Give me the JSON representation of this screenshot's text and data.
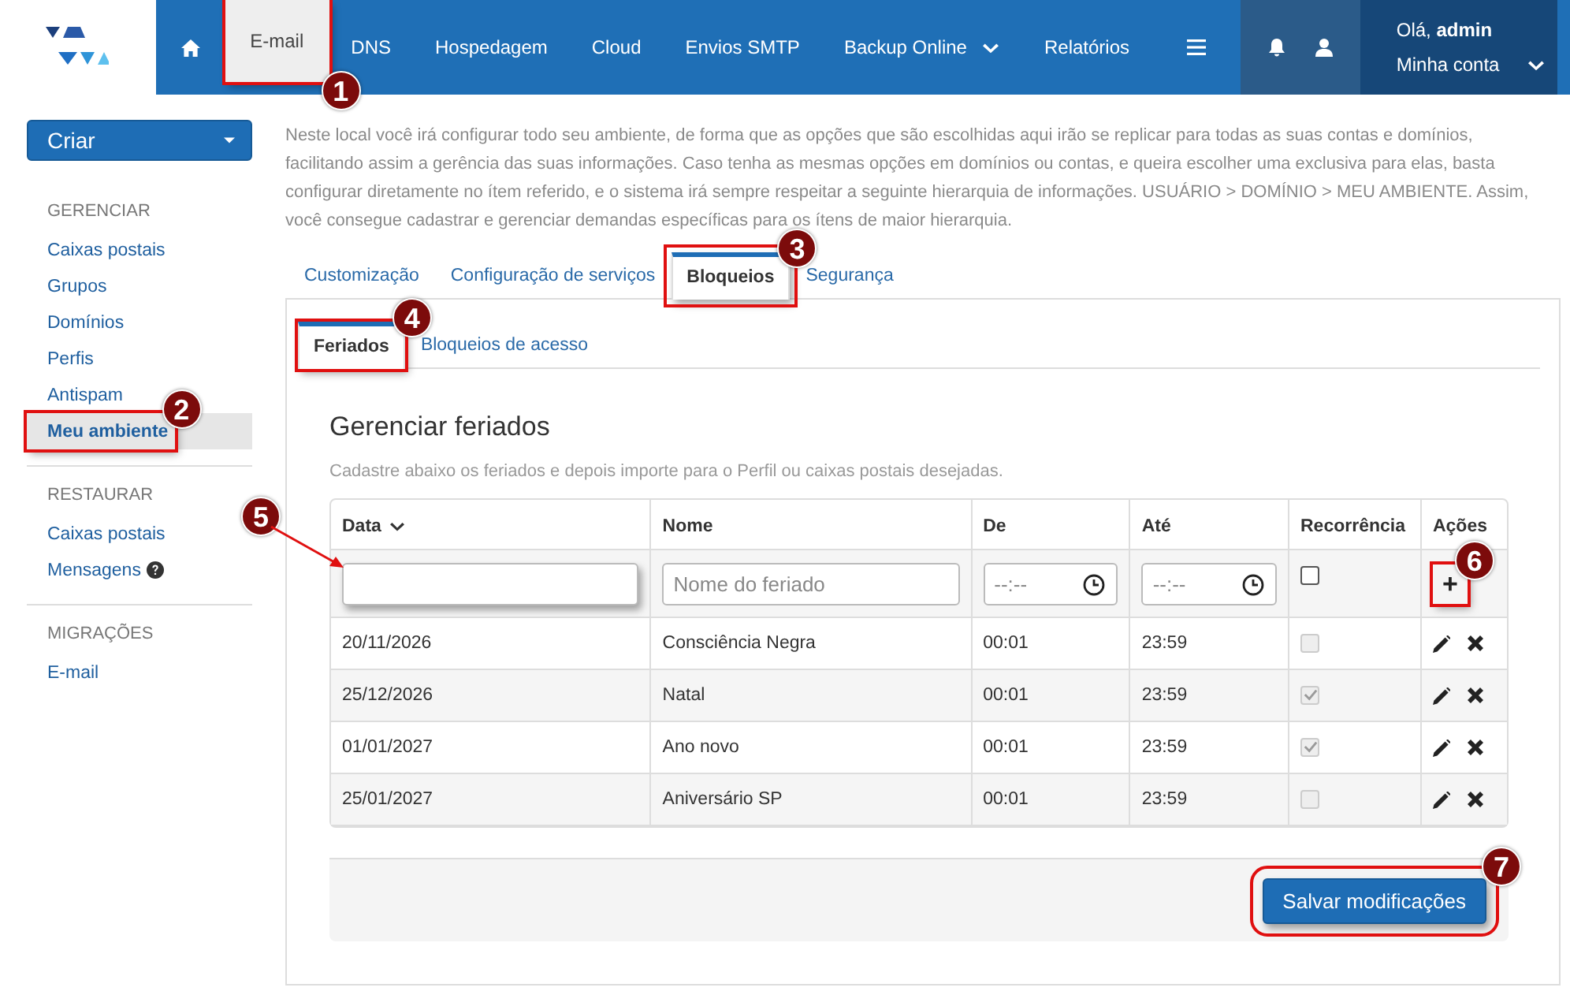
{
  "nav": {
    "items": [
      {
        "label": "E-mail",
        "selected": true,
        "callout": "1"
      },
      {
        "label": "DNS",
        "selected": false
      },
      {
        "label": "Hospedagem",
        "selected": false
      },
      {
        "label": "Cloud",
        "selected": false
      },
      {
        "label": "Envios SMTP",
        "selected": false
      },
      {
        "label": "Backup Online",
        "selected": false,
        "dropdown": true
      },
      {
        "label": "Relatórios",
        "selected": false
      }
    ]
  },
  "user": {
    "greeting": "Olá, **admin**",
    "account": "Minha conta"
  },
  "sidebar": {
    "create_button": "Criar",
    "sections": [
      {
        "title": "GERENCIAR",
        "items": [
          {
            "label": "Caixas postais",
            "selected": false
          },
          {
            "label": "Grupos",
            "selected": false
          },
          {
            "label": "Domínios",
            "selected": false
          },
          {
            "label": "Perfis",
            "selected": false
          },
          {
            "label": "Antispam",
            "selected": false
          },
          {
            "label": "Meu ambiente",
            "selected": true,
            "callout": "2"
          }
        ]
      },
      {
        "title": "RESTAURAR",
        "items": [
          {
            "label": "Caixas postais",
            "selected": false
          },
          {
            "label": "Mensagens",
            "selected": false,
            "help": true
          }
        ]
      },
      {
        "title": "MIGRAÇÕES",
        "items": [
          {
            "label": "E-mail",
            "selected": false
          }
        ]
      }
    ]
  },
  "intro": "Neste local você irá configurar todo seu ambiente, de forma que as opções que são escolhidas aqui irão se replicar para todas as suas contas e domínios, facilitando assim a gerência das suas informações. Caso tenha as mesmas opções em domínios ou contas, e queira escolher uma exclusiva para elas, basta configurar diretamente no ítem referido, e o sistema irá sempre respeitar a seguinte hierarquia de informações. USUÁRIO > DOMÍNIO > MEU AMBIENTE. Assim, você consegue cadastrar e gerenciar demandas específicas para os ítens de maior hierarquia.",
  "tabs": [
    {
      "label": "Customização",
      "selected": false
    },
    {
      "label": "Configuração de serviços",
      "selected": false
    },
    {
      "label": "Bloqueios",
      "selected": true,
      "callout": "3"
    },
    {
      "label": "Segurança",
      "selected": false
    }
  ],
  "subtabs": [
    {
      "label": "Feriados",
      "selected": true,
      "callout": "4"
    },
    {
      "label": "Bloqueios de acesso",
      "selected": false
    }
  ],
  "section": {
    "title": "Gerenciar feriados",
    "subtitle": "Cadastre abaixo os feriados e depois importe para o Perfil ou caixas postais desejadas."
  },
  "table": {
    "columns": [
      {
        "label": "Data",
        "sortable": true
      },
      {
        "label": "Nome",
        "sortable": false
      },
      {
        "label": "De",
        "sortable": false
      },
      {
        "label": "Até",
        "sortable": false
      },
      {
        "label": "Recorrência",
        "sortable": false
      },
      {
        "label": "Ações",
        "sortable": false
      }
    ],
    "new_row": {
      "date_field": {
        "callout": "5"
      },
      "name_field": {
        "placeholder": "Nome do feriado"
      },
      "from_field": {
        "placeholder": "--:--"
      },
      "to_field": {
        "placeholder": "--:--"
      },
      "recurring": false,
      "add_button": {
        "label": "+",
        "callout": "6"
      }
    },
    "rows": [
      {
        "date": "20/11/2026",
        "name": "Consciência Negra",
        "from": "00:01",
        "to": "23:59",
        "recurring": false
      },
      {
        "date": "25/12/2026",
        "name": "Natal",
        "from": "00:01",
        "to": "23:59",
        "recurring": true
      },
      {
        "date": "01/01/2027",
        "name": "Ano novo",
        "from": "00:01",
        "to": "23:59",
        "recurring": true
      },
      {
        "date": "25/01/2027",
        "name": "Aniversário SP",
        "from": "00:01",
        "to": "23:59",
        "recurring": false
      }
    ]
  },
  "save_button": {
    "label": "Salvar modificações",
    "callout": "7"
  }
}
